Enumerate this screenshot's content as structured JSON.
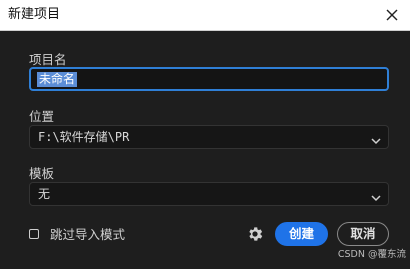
{
  "dialog": {
    "title": "新建项目"
  },
  "name_field": {
    "label": "项目名",
    "value": "未命名"
  },
  "location_field": {
    "label": "位置",
    "value": "F:\\软件存储\\PR"
  },
  "template_field": {
    "label": "模板",
    "value": "无"
  },
  "skip_import": {
    "label": "跳过导入模式",
    "checked": false
  },
  "buttons": {
    "create_label": "创建",
    "cancel_label": "取消"
  },
  "watermark": "CSDN @覆东流",
  "colors": {
    "accent": "#1f73e8",
    "background": "#1e1e1e",
    "selection": "#5b8dd6"
  }
}
